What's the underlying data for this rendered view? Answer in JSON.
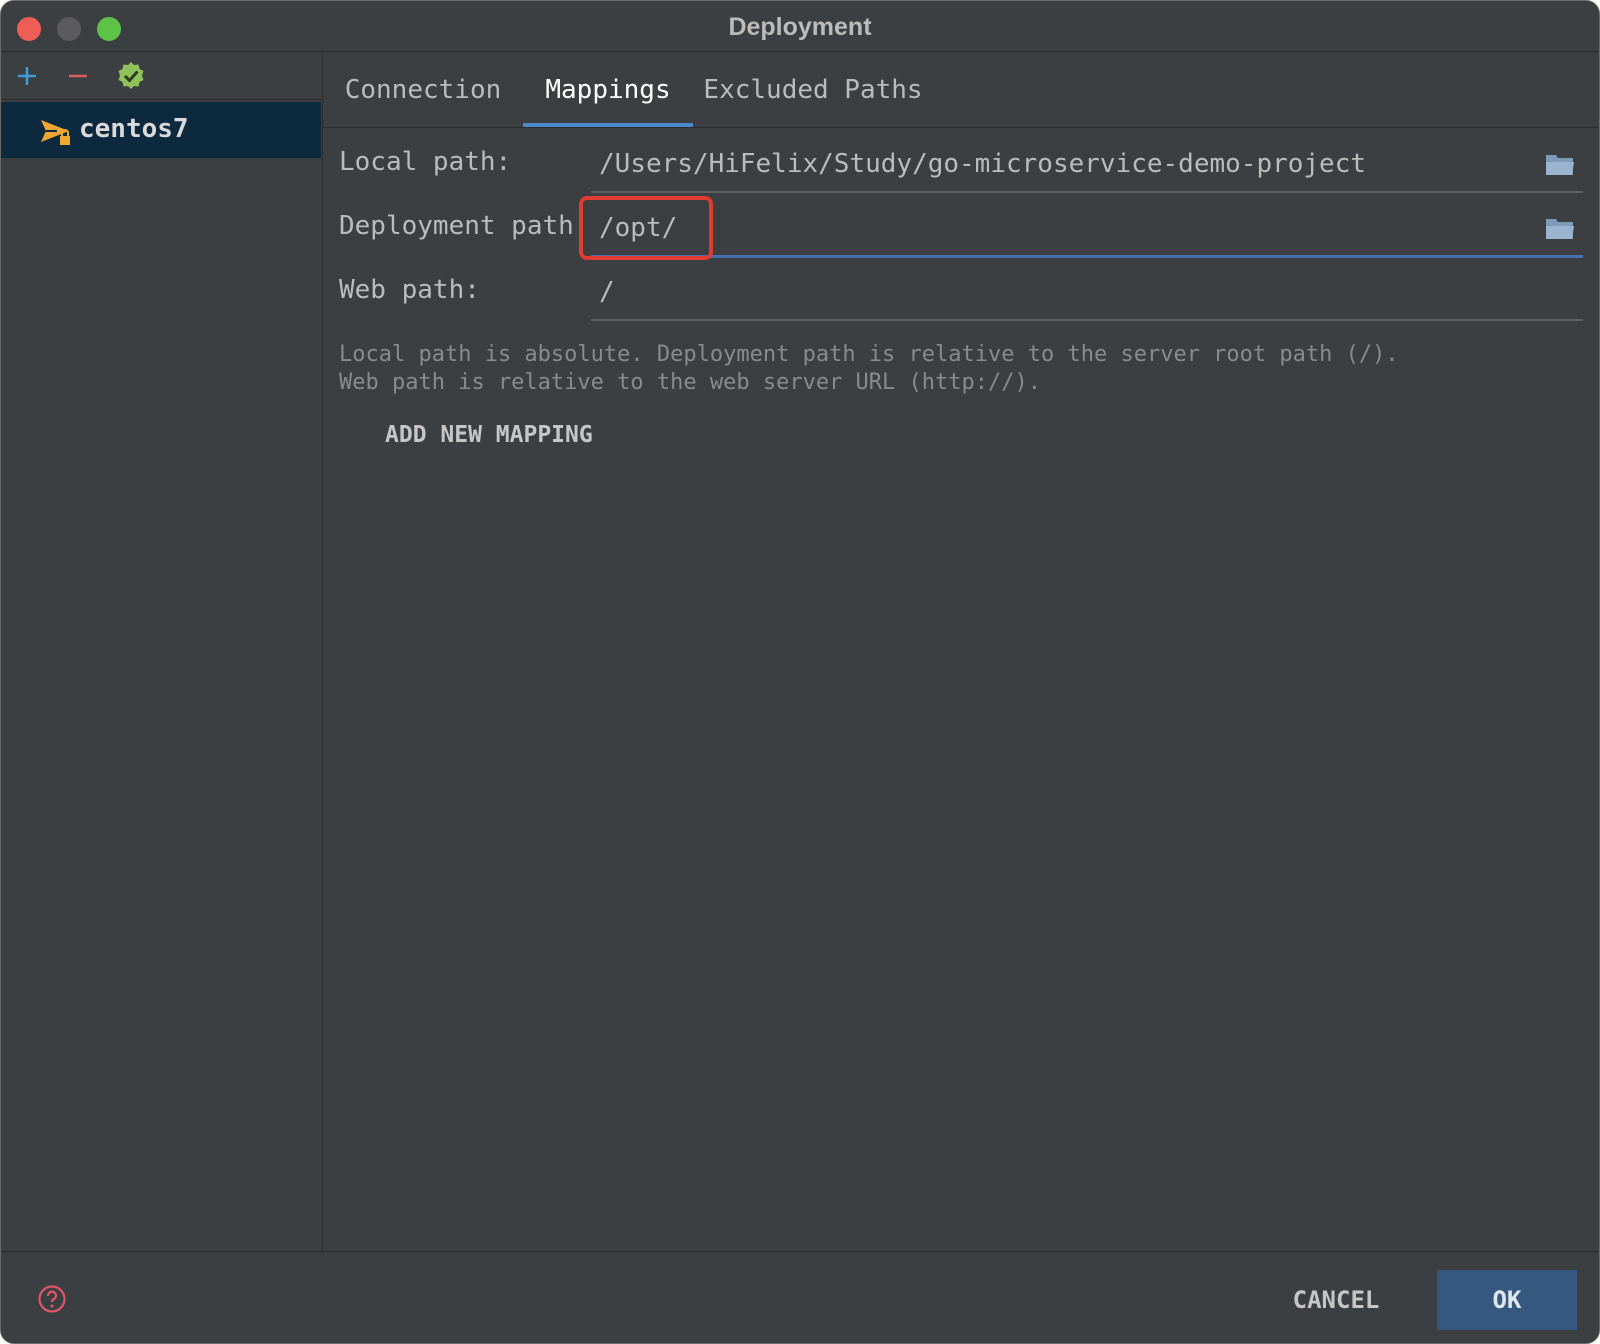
{
  "window": {
    "title": "Deployment"
  },
  "sidebar": {
    "toolbar": {
      "add_icon": "plus-icon",
      "remove_icon": "minus-icon",
      "default_icon": "check-badge-icon"
    },
    "items": [
      {
        "label": "centos7",
        "icon": "sftp-server-icon",
        "selected": true
      }
    ]
  },
  "tabs": [
    {
      "label": "Connection",
      "active": false
    },
    {
      "label": "Mappings",
      "active": true
    },
    {
      "label": "Excluded Paths",
      "active": false
    }
  ],
  "mappings": {
    "local_path_label": "Local path:",
    "local_path_value": "/Users/HiFelix/Study/go-microservice-demo-project",
    "deployment_path_label": "Deployment path",
    "deployment_path_value": "/opt/",
    "web_path_label": "Web path:",
    "web_path_value": "/",
    "hint_line_1": "Local path is absolute. Deployment path is relative to the server root path (/).",
    "hint_line_2": "Web path is relative to the web server URL (http://).",
    "add_new_mapping": "ADD NEW MAPPING"
  },
  "footer": {
    "help_icon": "help-icon",
    "cancel_label": "CANCEL",
    "ok_label": "OK"
  },
  "colors": {
    "background": "#3c3f41",
    "selection": "#0d293e",
    "accent": "#4a88c7",
    "ok_button": "#365880",
    "highlight": "#e03c31",
    "close": "#ee5e57",
    "minimize": "#5b5b5d",
    "maximize": "#5dc248"
  }
}
